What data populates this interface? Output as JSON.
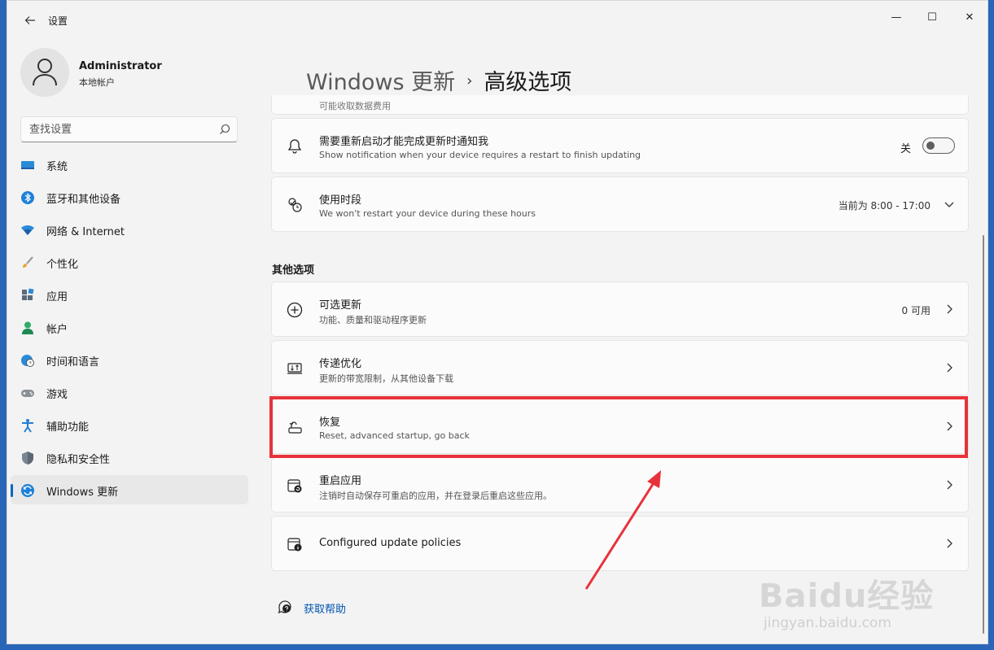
{
  "window": {
    "title": "设置",
    "minimize": "—",
    "maximize": "☐",
    "close": "✕"
  },
  "profile": {
    "name": "Administrator",
    "account_type": "本地帐户"
  },
  "search": {
    "placeholder": "查找设置"
  },
  "sidebar": {
    "items": [
      {
        "label": "系统",
        "icon": "system-icon",
        "active": false
      },
      {
        "label": "蓝牙和其他设备",
        "icon": "bluetooth-icon",
        "active": false
      },
      {
        "label": "网络 & Internet",
        "icon": "wifi-icon",
        "active": false
      },
      {
        "label": "个性化",
        "icon": "brush-icon",
        "active": false
      },
      {
        "label": "应用",
        "icon": "apps-icon",
        "active": false
      },
      {
        "label": "帐户",
        "icon": "account-icon",
        "active": false
      },
      {
        "label": "时间和语言",
        "icon": "globe-clock-icon",
        "active": false
      },
      {
        "label": "游戏",
        "icon": "gamepad-icon",
        "active": false
      },
      {
        "label": "辅助功能",
        "icon": "accessibility-icon",
        "active": false
      },
      {
        "label": "隐私和安全性",
        "icon": "shield-icon",
        "active": false
      },
      {
        "label": "Windows 更新",
        "icon": "windows-update-icon",
        "active": true
      }
    ]
  },
  "breadcrumb": {
    "parent": "Windows 更新",
    "separator": "›",
    "current": "高级选项"
  },
  "main": {
    "partial_card_sub": "可能收取数据费用",
    "notify_restart": {
      "title": "需要重新启动才能完成更新时通知我",
      "subtitle": "Show notification when your device requires a restart to finish updating",
      "toggle_label": "关",
      "toggle_on": false
    },
    "active_hours": {
      "title": "使用时段",
      "subtitle": "We won't restart your device during these hours",
      "value": "当前为 8:00 - 17:00"
    },
    "section_title": "其他选项",
    "optional_updates": {
      "title": "可选更新",
      "subtitle": "功能、质量和驱动程序更新",
      "value": "0 可用"
    },
    "delivery_optimization": {
      "title": "传递优化",
      "subtitle": "更新的带宽限制，从其他设备下载"
    },
    "recovery": {
      "title": "恢复",
      "subtitle": "Reset, advanced startup, go back"
    },
    "restart_apps": {
      "title": "重启应用",
      "subtitle": "注销时自动保存可重启的应用，并在登录后重启这些应用。"
    },
    "configured_policies": {
      "title": "Configured update policies"
    }
  },
  "help": {
    "label": "获取帮助"
  },
  "watermark": {
    "brand": "Baidu经验",
    "url": "jingyan.baidu.com"
  },
  "colors": {
    "accent": "#0067c0",
    "highlight": "#e8323a"
  }
}
